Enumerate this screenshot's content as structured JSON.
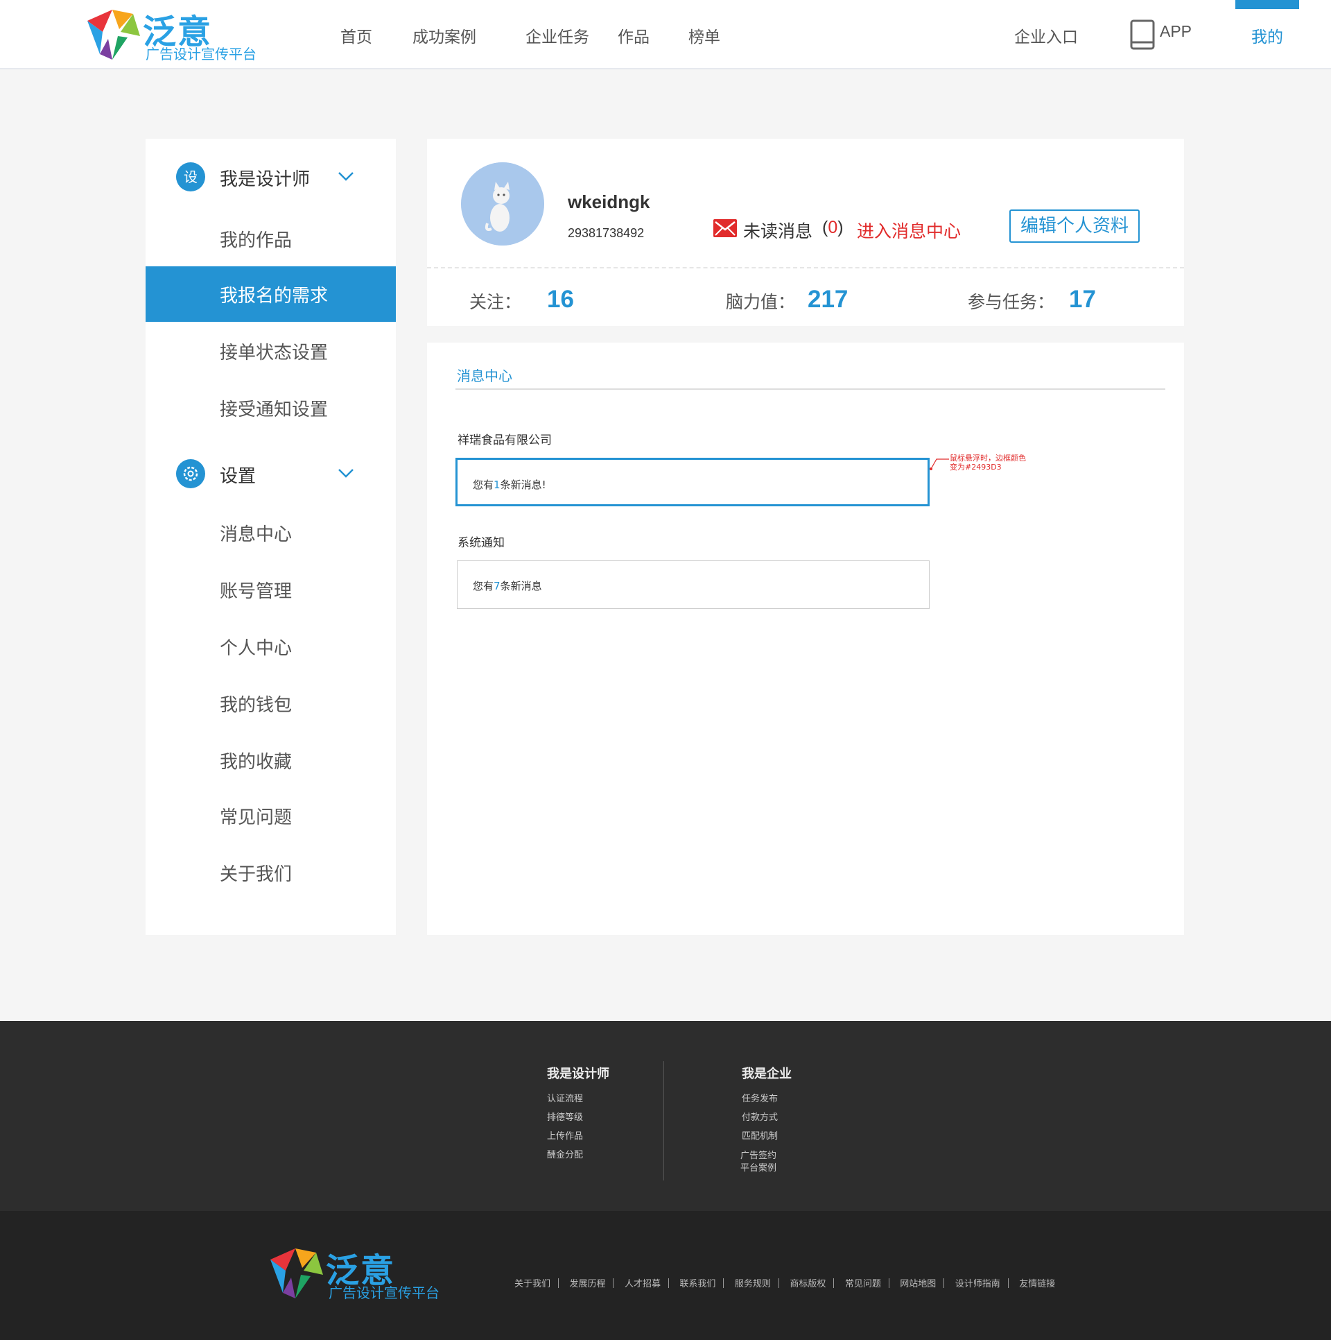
{
  "header": {
    "logo_title": "泛意",
    "logo_subtitle": "广告设计宣传平台",
    "nav": [
      "首页",
      "成功案例",
      "企业任务",
      "作品",
      "榜单"
    ],
    "enterprise_entry": "企业入口",
    "app_label": "APP",
    "mine_label": "我的",
    "accent": "#2493d3"
  },
  "sidebar": {
    "designer_section": {
      "icon_text": "设",
      "label": "我是设计师"
    },
    "designer_items": [
      "我的作品",
      "我报名的需求",
      "接单状态设置",
      "接受通知设置"
    ],
    "active_item": "我报名的需求",
    "settings_section": {
      "label": "设置"
    },
    "settings_items": [
      "消息中心",
      "账号管理",
      "个人中心",
      "我的钱包",
      "我的收藏",
      "常见问题",
      "关于我们"
    ]
  },
  "profile": {
    "username": "wkeidngk",
    "user_id": "29381738492",
    "unread_label": "未读消息",
    "unread_count": "0",
    "enter_message_center": "进入消息中心",
    "edit_profile": "编辑个人资料",
    "stats": [
      {
        "label": "关注：",
        "value": "16"
      },
      {
        "label": "脑力值：",
        "value": "217"
      },
      {
        "label": "参与任务：",
        "value": "17"
      }
    ]
  },
  "messages": {
    "title": "消息中心",
    "groups": [
      {
        "label": "祥瑞食品有限公司",
        "prefix": "您有",
        "count": "1",
        "suffix": "条新消息!"
      },
      {
        "label": "系统通知",
        "prefix": "您有",
        "count": "7",
        "suffix": "条新消息"
      }
    ],
    "annotation": "鼠标悬浮时，边框颜色变为#2493D3",
    "hover_border_color": "#2493d3"
  },
  "footer": {
    "col1_title": "我是设计师",
    "col1_links": [
      "认证流程",
      "排德等级",
      "上传作品",
      "酬金分配"
    ],
    "col2_title": "我是企业",
    "col2_links": [
      "任务发布",
      "付款方式",
      "匹配机制",
      "广告签约",
      "平台案例"
    ],
    "bottom_links": [
      "关于我们",
      "发展历程",
      "人才招募",
      "联系我们",
      "服务规则",
      "商标版权",
      "常见问题",
      "网站地图",
      "设计师指南",
      "友情链接"
    ]
  }
}
